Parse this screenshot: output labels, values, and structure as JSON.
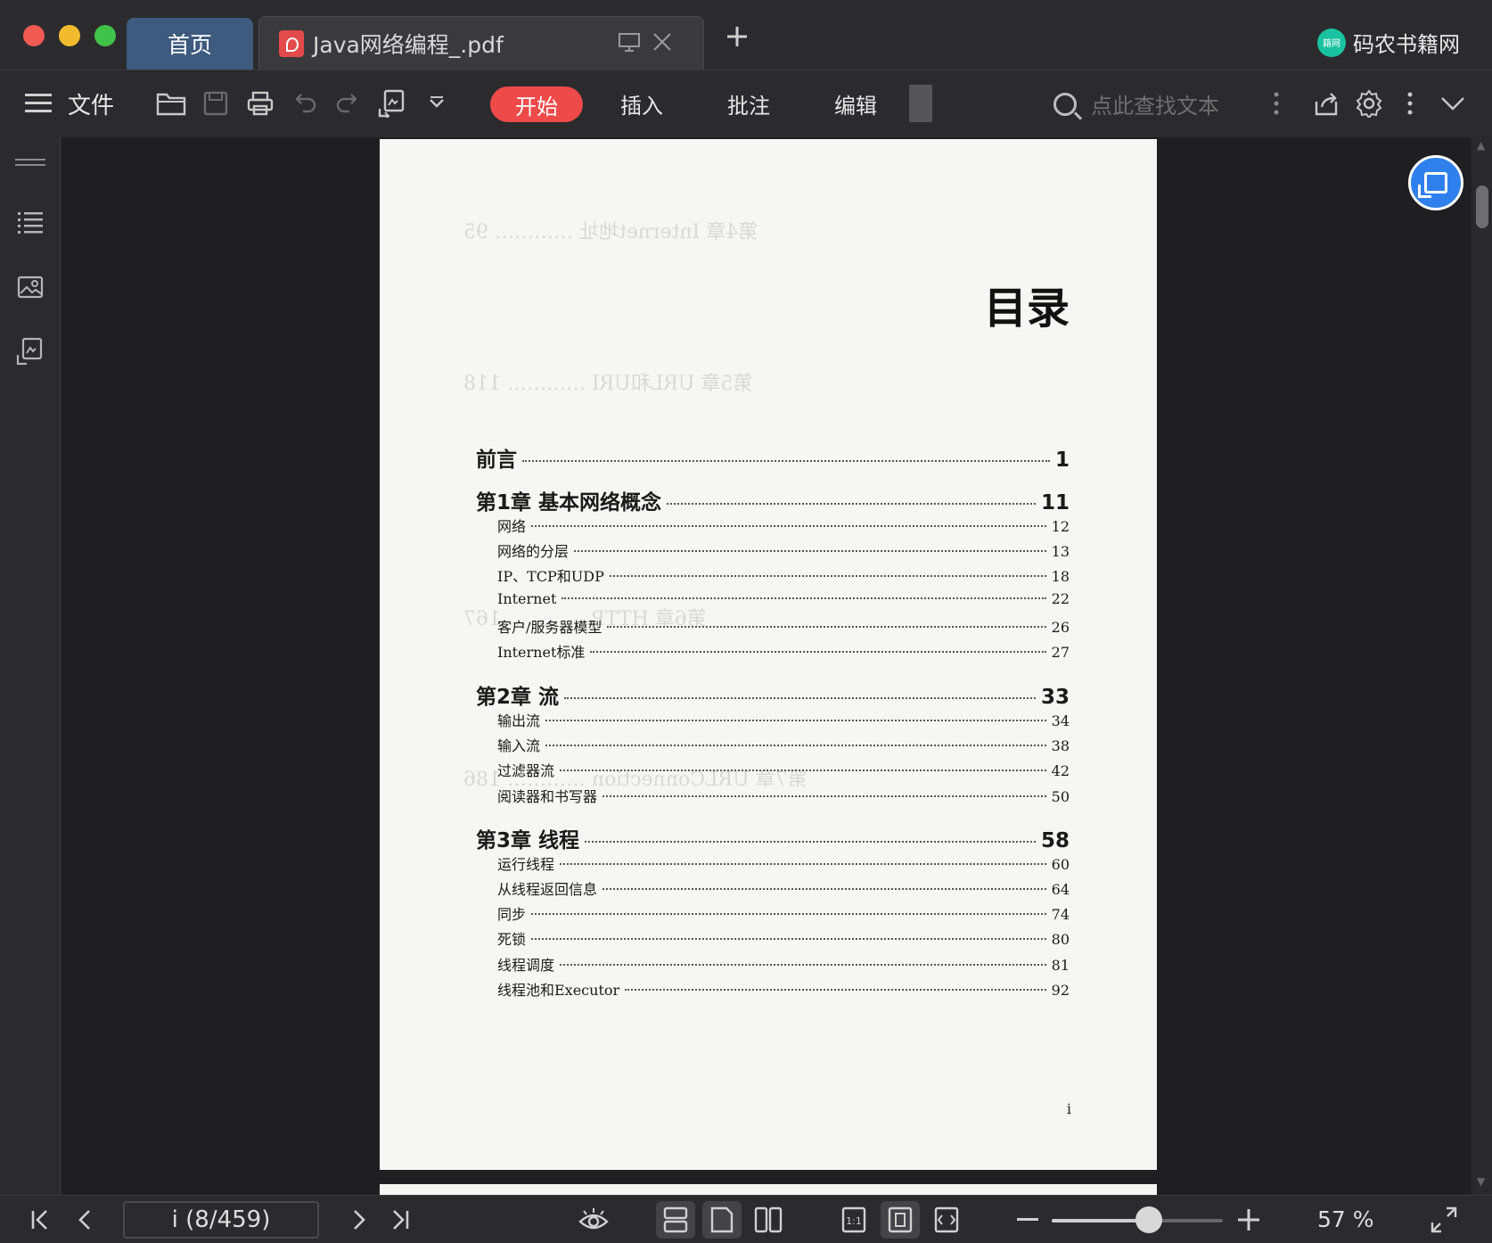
{
  "tabs": {
    "home_label": "首页",
    "doc_title": "Java网络编程_.pdf",
    "brand_name": "码农书籍网",
    "brand_logo_text": "籍网"
  },
  "toolbar": {
    "file_label": "文件",
    "start_label": "开始",
    "insert_label": "插入",
    "annotate_label": "批注",
    "edit_label": "编辑",
    "search_placeholder": "点此查找文本"
  },
  "document": {
    "toc_title": "目录",
    "entries": [
      {
        "label": "前言",
        "page": "1",
        "level": "chapter"
      },
      {
        "label": "第1章 基本网络概念",
        "page": "11",
        "level": "chapter"
      },
      {
        "label": "网络",
        "page": "12",
        "level": "sub"
      },
      {
        "label": "网络的分层",
        "page": "13",
        "level": "sub"
      },
      {
        "label": "IP、TCP和UDP",
        "page": "18",
        "level": "sub"
      },
      {
        "label": "Internet",
        "page": "22",
        "level": "sub"
      },
      {
        "label": "客户/服务器模型",
        "page": "26",
        "level": "sub"
      },
      {
        "label": "Internet标准",
        "page": "27",
        "level": "sub"
      },
      {
        "label": "第2章 流",
        "page": "33",
        "level": "chapter"
      },
      {
        "label": "输出流",
        "page": "34",
        "level": "sub"
      },
      {
        "label": "输入流",
        "page": "38",
        "level": "sub"
      },
      {
        "label": "过滤器流",
        "page": "42",
        "level": "sub"
      },
      {
        "label": "阅读器和书写器",
        "page": "50",
        "level": "sub"
      },
      {
        "label": "第3章 线程",
        "page": "58",
        "level": "chapter"
      },
      {
        "label": "运行线程",
        "page": "60",
        "level": "sub"
      },
      {
        "label": "从线程返回信息",
        "page": "64",
        "level": "sub"
      },
      {
        "label": "同步",
        "page": "74",
        "level": "sub"
      },
      {
        "label": "死锁",
        "page": "80",
        "level": "sub"
      },
      {
        "label": "线程调度",
        "page": "81",
        "level": "sub"
      },
      {
        "label": "线程池和Executor",
        "page": "92",
        "level": "sub"
      }
    ],
    "page_footer": "i",
    "bleed_through": [
      "第4章 Internet地址 ………… 95",
      "第5章 URL和URI ………… 118",
      "第6章 HTTP ………… 167",
      "第7章 URLConnection ………… 186"
    ]
  },
  "status": {
    "page_indicator": "i (8/459)",
    "zoom_value": 0.57,
    "zoom_label": "57 %"
  },
  "colors": {
    "accent_red": "#ef4a4a",
    "home_tab": "#3e5a7f",
    "float_button": "#2f80ed",
    "brand_logo": "#19c2a0"
  }
}
